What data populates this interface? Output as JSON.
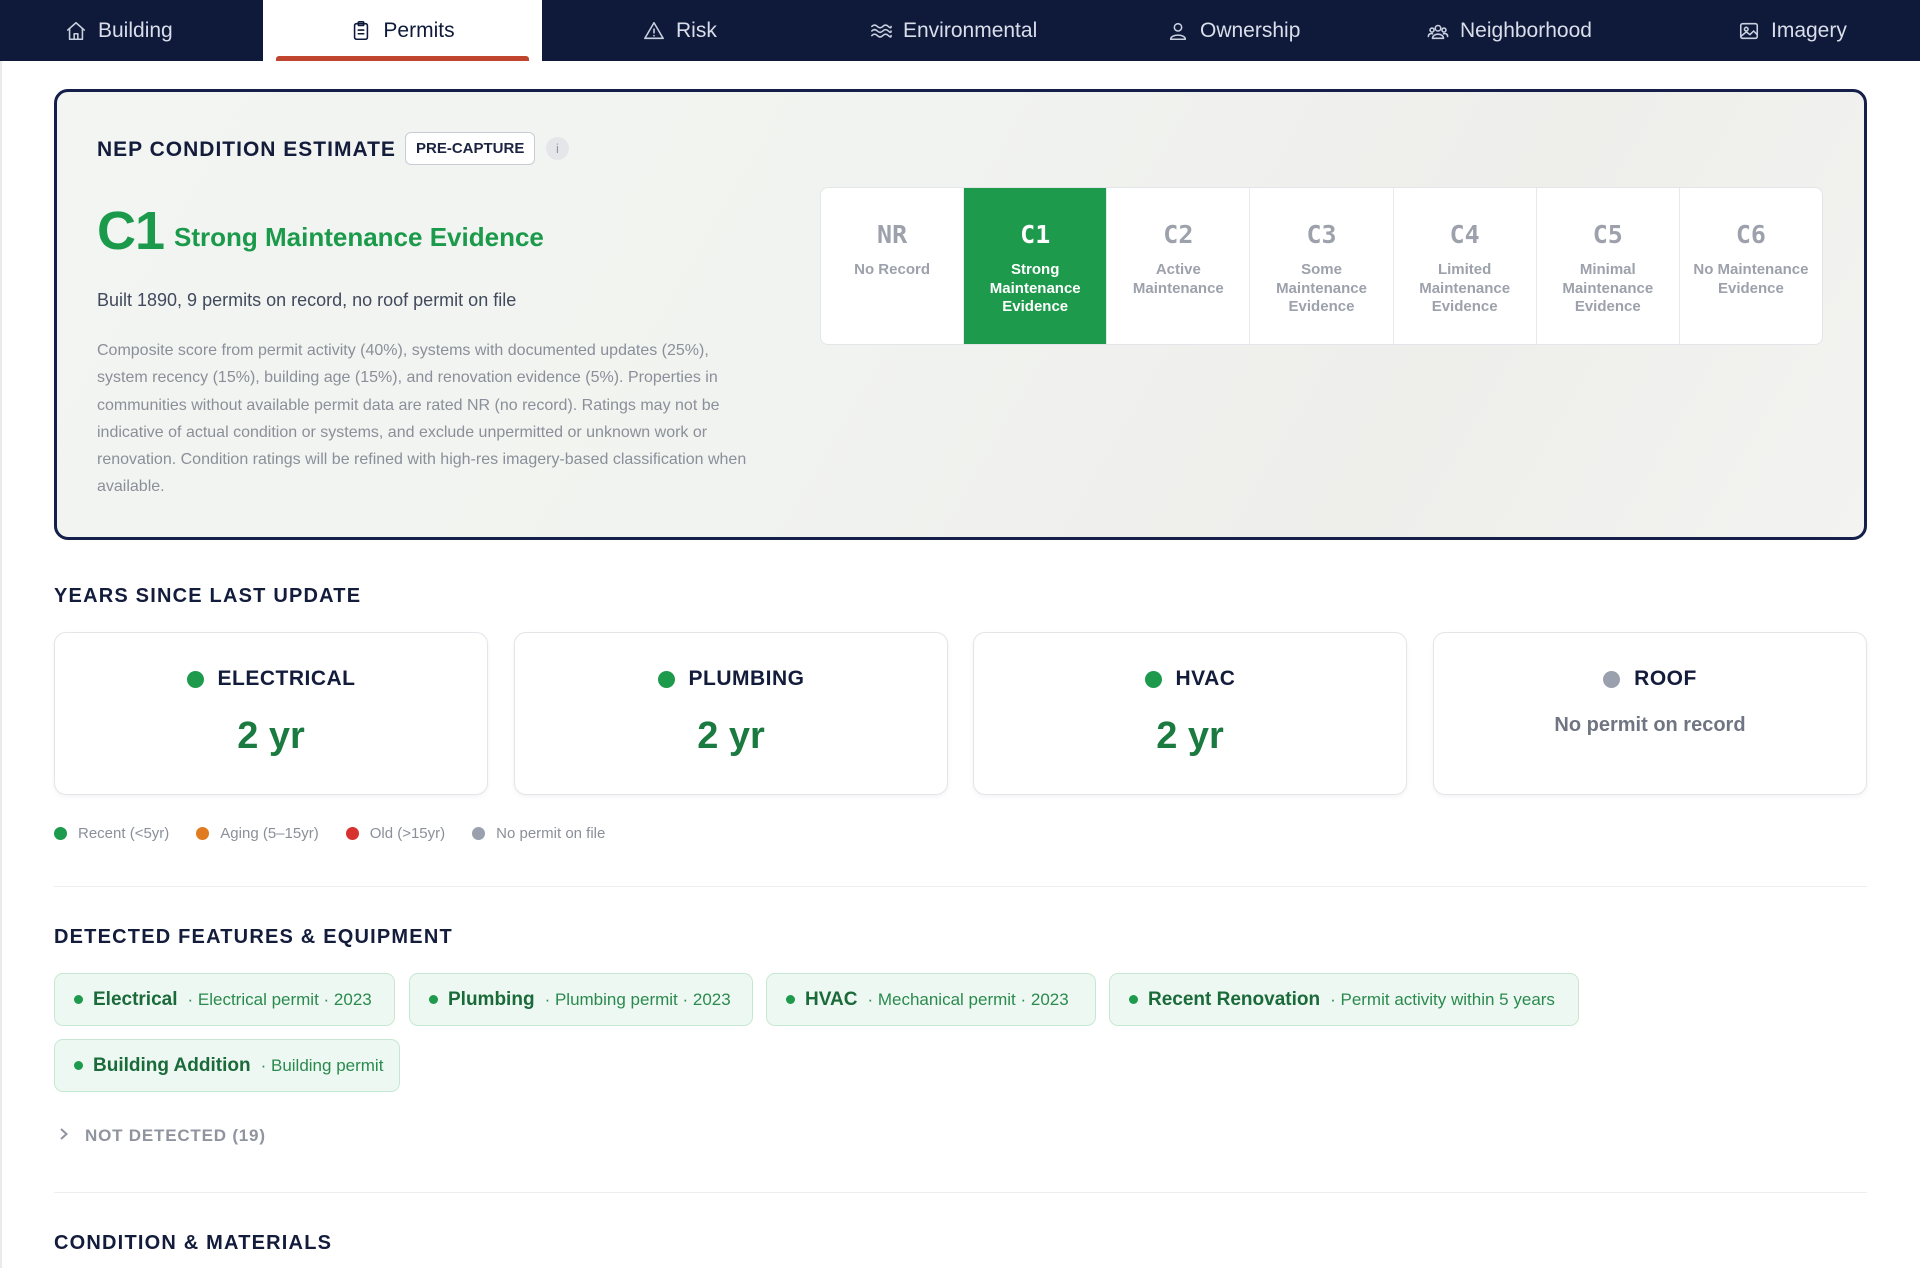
{
  "tabs": [
    {
      "label": "Building",
      "icon": "home-icon"
    },
    {
      "label": "Permits",
      "icon": "clipboard-icon",
      "active": true
    },
    {
      "label": "Risk",
      "icon": "warning-triangle-icon"
    },
    {
      "label": "Environmental",
      "icon": "waves-icon"
    },
    {
      "label": "Ownership",
      "icon": "person-icon"
    },
    {
      "label": "Neighborhood",
      "icon": "group-icon"
    },
    {
      "label": "Imagery",
      "icon": "image-icon"
    }
  ],
  "condition": {
    "title": "NEP CONDITION ESTIMATE",
    "badge": "PRE-CAPTURE",
    "info": "i",
    "grade_code": "C1",
    "grade_name": "Strong Maintenance Evidence",
    "summary": "Built 1890, 9 permits on record, no roof permit on file",
    "description": "Composite score from permit activity (40%), systems with documented updates (25%), system recency (15%), building age (15%), and renovation evidence (5%). Properties in communities without available permit data are rated NR (no record). Ratings may not be indicative of actual condition or systems, and exclude unpermitted or unknown work or renovation. Condition ratings will be refined with high-res imagery-based classification when available.",
    "scale": [
      {
        "code": "NR",
        "label": "No Record"
      },
      {
        "code": "C1",
        "label": "Strong Maintenance Evidence",
        "active": true
      },
      {
        "code": "C2",
        "label": "Active Maintenance"
      },
      {
        "code": "C3",
        "label": "Some Maintenance Evidence"
      },
      {
        "code": "C4",
        "label": "Limited Maintenance Evidence"
      },
      {
        "code": "C5",
        "label": "Minimal Maintenance Evidence"
      },
      {
        "code": "C6",
        "label": "No Maintenance Evidence"
      }
    ]
  },
  "years_section": {
    "title": "YEARS SINCE LAST UPDATE",
    "cards": [
      {
        "name": "ELECTRICAL",
        "value": "2 yr",
        "status_color": "#1e9a4c"
      },
      {
        "name": "PLUMBING",
        "value": "2 yr",
        "status_color": "#1e9a4c"
      },
      {
        "name": "HVAC",
        "value": "2 yr",
        "status_color": "#1e9a4c"
      },
      {
        "name": "ROOF",
        "value": "No permit on record",
        "status_color": "#9aa0ad",
        "none": true
      }
    ],
    "legend": [
      {
        "label": "Recent (<5yr)",
        "color": "#1e9a4c"
      },
      {
        "label": "Aging (5–15yr)",
        "color": "#e07b1f"
      },
      {
        "label": "Old (>15yr)",
        "color": "#d8322f"
      },
      {
        "label": "No permit on file",
        "color": "#9aa0ad"
      }
    ]
  },
  "features_section": {
    "title": "DETECTED FEATURES & EQUIPMENT",
    "chips": [
      {
        "name": "Electrical",
        "detail": "· Electrical permit · 2023"
      },
      {
        "name": "Plumbing",
        "detail": "· Plumbing permit · 2023"
      },
      {
        "name": "HVAC",
        "detail": "· Mechanical permit · 2023"
      },
      {
        "name": "Recent Renovation",
        "detail": "· Permit activity within 5 years"
      },
      {
        "name": "Building Addition",
        "detail": "· Building permit"
      }
    ],
    "not_detected": "NOT DETECTED (19)"
  },
  "materials_section": {
    "title": "CONDITION & MATERIALS"
  }
}
